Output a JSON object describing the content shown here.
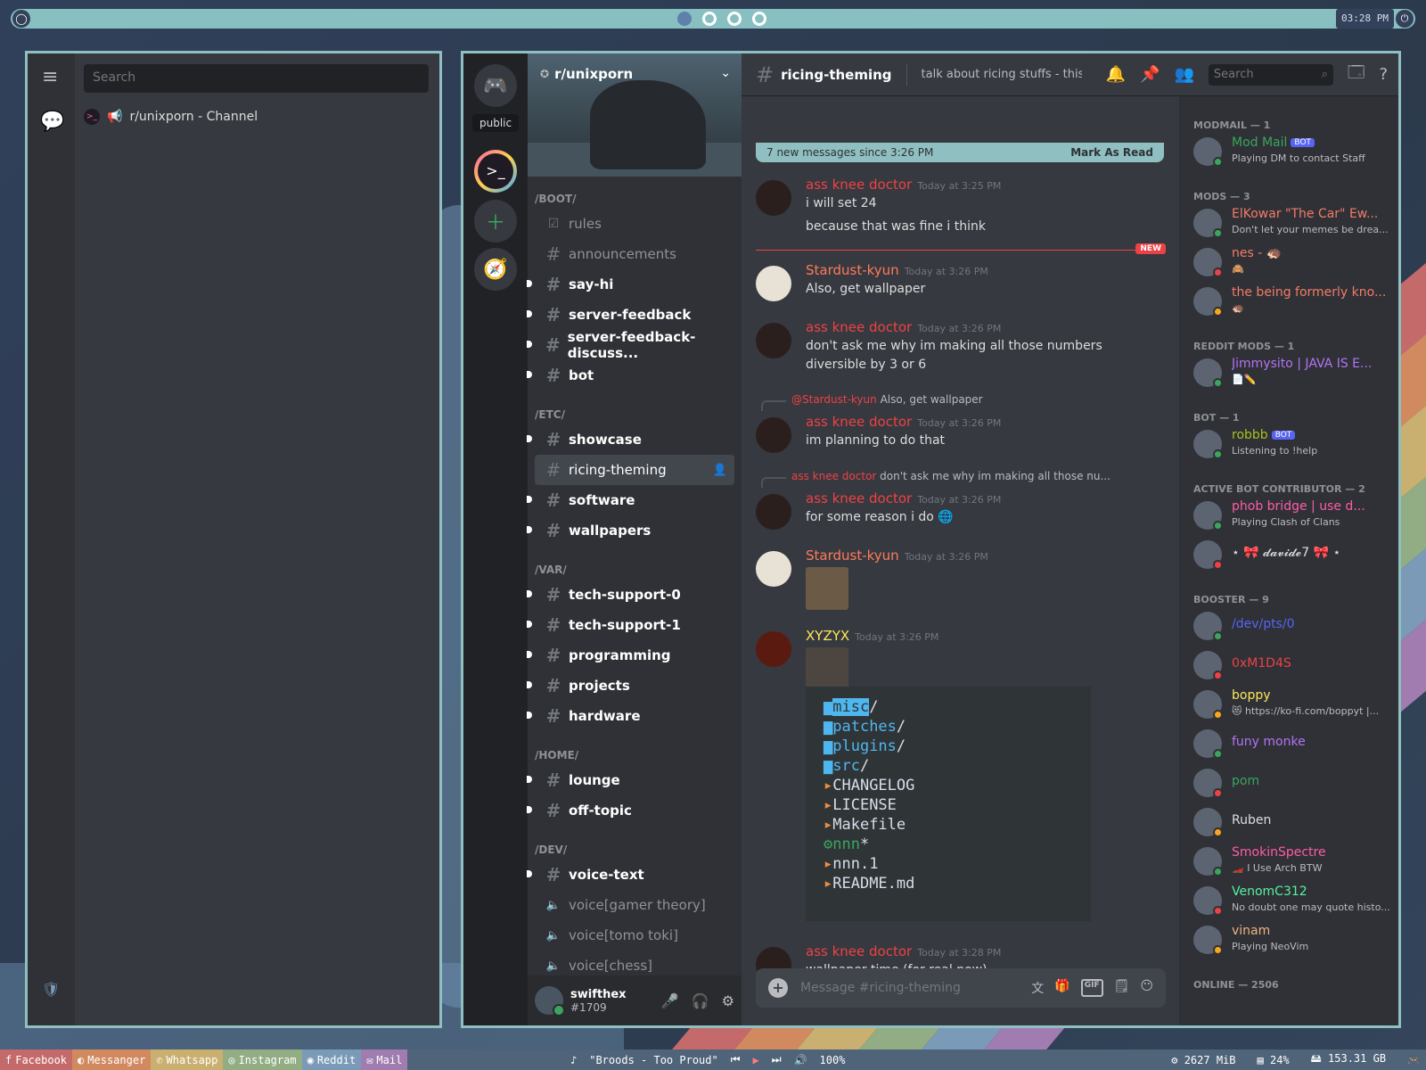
{
  "topbar": {
    "clock": "03:28 PM"
  },
  "left_window": {
    "search_placeholder": "Search",
    "result_label": "r/unixporn - Channel"
  },
  "discord": {
    "public_tooltip": "public",
    "server_name": "r/unixporn",
    "categories": [
      {
        "name": "/BOOT/",
        "channels": [
          {
            "name": "rules",
            "kind": "rules",
            "unread": false
          },
          {
            "name": "announcements",
            "kind": "text",
            "unread": false
          },
          {
            "name": "say-hi",
            "kind": "text",
            "unread": true
          },
          {
            "name": "server-feedback",
            "kind": "text",
            "unread": true
          },
          {
            "name": "server-feedback-discuss...",
            "kind": "text",
            "unread": true
          },
          {
            "name": "bot",
            "kind": "text",
            "unread": true
          }
        ]
      },
      {
        "name": "/ETC/",
        "channels": [
          {
            "name": "showcase",
            "kind": "text",
            "unread": true
          },
          {
            "name": "ricing-theming",
            "kind": "text",
            "unread": false,
            "active": true
          },
          {
            "name": "software",
            "kind": "text",
            "unread": true
          },
          {
            "name": "wallpapers",
            "kind": "text",
            "unread": true
          }
        ]
      },
      {
        "name": "/VAR/",
        "channels": [
          {
            "name": "tech-support-0",
            "kind": "text",
            "unread": true
          },
          {
            "name": "tech-support-1",
            "kind": "text",
            "unread": true
          },
          {
            "name": "programming",
            "kind": "text",
            "unread": true
          },
          {
            "name": "projects",
            "kind": "text",
            "unread": true
          },
          {
            "name": "hardware",
            "kind": "text",
            "unread": true
          }
        ]
      },
      {
        "name": "/HOME/",
        "channels": [
          {
            "name": "lounge",
            "kind": "text",
            "unread": true
          },
          {
            "name": "off-topic",
            "kind": "text",
            "unread": true
          }
        ]
      },
      {
        "name": "/DEV/",
        "channels": [
          {
            "name": "voice-text",
            "kind": "text",
            "unread": true
          },
          {
            "name": "voice[gamer theory]",
            "kind": "voice",
            "unread": false
          },
          {
            "name": "voice[tomo toki]",
            "kind": "voice",
            "unread": false
          },
          {
            "name": "voice[chess]",
            "kind": "voice",
            "unread": false
          }
        ]
      }
    ],
    "user": {
      "name": "swifthex",
      "tag": "#1709"
    },
    "header": {
      "channel": "ricing-theming",
      "topic": "talk about ricing stuffs - this...",
      "search_placeholder": "Search"
    },
    "new_messages": {
      "text": "7 new messages since 3:26 PM",
      "action": "Mark As Read"
    },
    "new_badge": "NEW",
    "messages": [
      {
        "author": "ass knee doctor",
        "time": "Today at 3:25 PM",
        "lines": [
          "i will set 24",
          "because that was fine i think"
        ]
      },
      {
        "author": "Stardust-kyun",
        "time": "Today at 3:26 PM",
        "lines": [
          "Also, get wallpaper"
        ]
      },
      {
        "author": "ass knee doctor",
        "time": "Today at 3:26 PM",
        "lines": [
          "don't ask me why im making all those numbers diversible by 3 or 6"
        ]
      },
      {
        "reply_to": "@Stardust-kyun",
        "reply_text": "Also, get wallpaper",
        "author": "ass knee doctor",
        "time": "Today at 3:26 PM",
        "lines": [
          "im planning to do that"
        ]
      },
      {
        "reply_to": "ass knee doctor",
        "reply_text": "don't ask me why im making all those nu...",
        "author": "ass knee doctor",
        "time": "Today at 3:26 PM",
        "lines": [
          "for some  reason i do"
        ]
      },
      {
        "author": "Stardust-kyun",
        "time": "Today at 3:26 PM",
        "lines": []
      },
      {
        "author": "XYZYX",
        "time": "Today at 3:26 PM",
        "lines": []
      },
      {
        "author": "ass knee doctor",
        "time": "Today at 3:28 PM",
        "lines": [
          "wallpaper time (for real now)"
        ]
      }
    ],
    "terminal": {
      "entries": [
        {
          "name": "misc",
          "suffix": "/",
          "type": "dir"
        },
        {
          "name": "patches",
          "suffix": "/",
          "type": "dir"
        },
        {
          "name": "plugins",
          "suffix": "/",
          "type": "dir"
        },
        {
          "name": "src",
          "suffix": "/",
          "type": "dir"
        },
        {
          "name": "CHANGELOG",
          "suffix": "",
          "type": "file"
        },
        {
          "name": "LICENSE",
          "suffix": "",
          "type": "file"
        },
        {
          "name": "Makefile",
          "suffix": "",
          "type": "file"
        },
        {
          "name": "nnn",
          "suffix": "*",
          "type": "exec"
        },
        {
          "name": "nnn.1",
          "suffix": "",
          "type": "file"
        },
        {
          "name": "README.md",
          "suffix": "",
          "type": "file"
        }
      ]
    },
    "composer_placeholder": "Message #ricing-theming",
    "gif_label": "GIF",
    "members": {
      "groups": [
        {
          "title": "MODMAIL — 1",
          "members": [
            {
              "name": "Mod Mail",
              "bot": "BOT",
              "status": "Playing DM to contact Staff",
              "color": "#3ba55d"
            }
          ]
        },
        {
          "title": "MODS — 3",
          "members": [
            {
              "name": "ElKowar \"The Car\" Ew...",
              "status": "Don't let your memes be drea...",
              "color": "#f47b67"
            },
            {
              "name": "nes - 🦔",
              "status": "🙈",
              "color": "#f47b67"
            },
            {
              "name": "the being formerly kno...",
              "status": "🦔",
              "color": "#f47b67"
            }
          ]
        },
        {
          "title": "REDDIT MODS — 1",
          "members": [
            {
              "name": "Jimmysito | JAVA IS E...",
              "status": "📄✏️",
              "color": "#b473f5"
            }
          ]
        },
        {
          "title": "BOT — 1",
          "members": [
            {
              "name": "robbb",
              "bot": "BOT",
              "status": "Listening to !help",
              "color": "#a8c023"
            }
          ]
        },
        {
          "title": "ACTIVE BOT CONTRIBUTOR — 2",
          "members": [
            {
              "name": "phob bridge | use d...",
              "status": "Playing Clash of Clans",
              "color": "#ff5ca8"
            },
            {
              "name": "⋆ 🎀 𝓭𝓪𝓿𝓲𝓭𝓮7 🎀 ⋆",
              "status": "",
              "color": "#dcddde"
            }
          ]
        },
        {
          "title": "BOOSTER — 9",
          "members": [
            {
              "name": "/dev/pts/0",
              "status": "",
              "color": "#5865f2"
            },
            {
              "name": "0xM1D4S",
              "status": "",
              "color": "#ed4245"
            },
            {
              "name": "boppy",
              "status": "😻 https://ko-fi.com/boppyt |...",
              "color": "#fee75c"
            },
            {
              "name": "funy monke",
              "status": "",
              "color": "#b473f5"
            },
            {
              "name": "pom",
              "status": "",
              "color": "#3ba55d"
            },
            {
              "name": "Ruben",
              "status": "",
              "color": "#dcddde"
            },
            {
              "name": "SmokinSpectre",
              "status": "🏎️ I Use Arch BTW",
              "color": "#ff5ca8"
            },
            {
              "name": "VenomC312",
              "status": "No doubt one may quote histo...",
              "color": "#57f2a0"
            },
            {
              "name": "vinam",
              "status": "Playing NeoVim",
              "color": "#f0b37e"
            }
          ]
        },
        {
          "title": "ONLINE — 2506",
          "members": []
        }
      ]
    }
  },
  "taskbar": {
    "apps": [
      "Facebook",
      "Messanger",
      "Whatsapp",
      "Instagram",
      "Reddit",
      "Mail"
    ],
    "track": "\"Broods - Too Proud\"",
    "volume": "100%",
    "memory": "2627 MiB",
    "cpu": "24%",
    "disk": "153.31 GB"
  }
}
